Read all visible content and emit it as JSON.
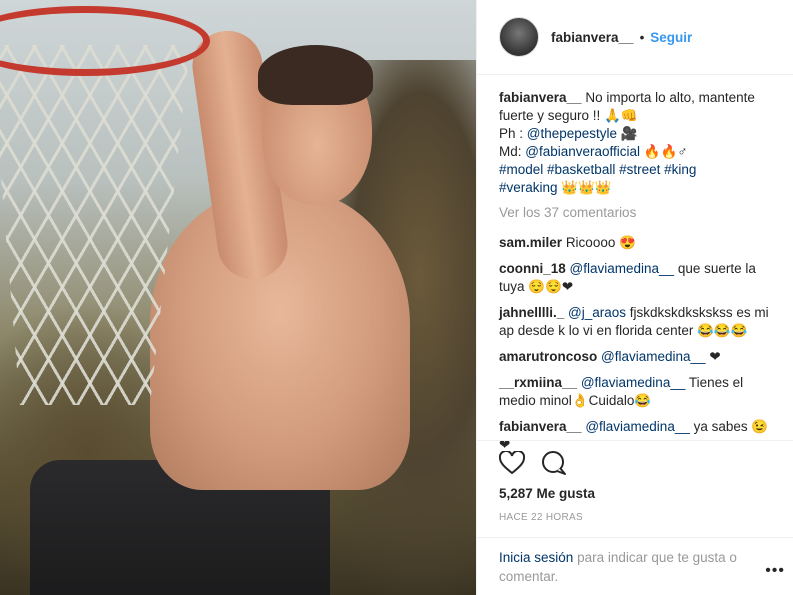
{
  "post": {
    "username": "fabianvera__",
    "follow_label": "Seguir",
    "separator": "•"
  },
  "caption": {
    "username": "fabianvera__",
    "line1": "No importa lo alto, mantente fuerte y seguro !! 🙏👊",
    "ph_prefix": "Ph :",
    "ph_handle": "@thepepestyle",
    "ph_suffix": "🎥",
    "md_prefix": "Md:",
    "md_handle": "@fabianveraofficial",
    "md_suffix": "🔥🔥♂",
    "tags": "#model #basketball #street #king",
    "tags2": "#veraking",
    "tags2_suffix": "👑👑👑"
  },
  "view_more": "Ver los 37 comentarios",
  "comments": [
    {
      "user": "sam.miler",
      "text": "Ricoooo 😍"
    },
    {
      "user": "coonni_18",
      "mention": "@flaviamedina__",
      "text": "que suerte la tuya 😌😌❤"
    },
    {
      "user": "jahnelllli._",
      "mention": "@j_araos",
      "text": "fjskdkskdkskskss es mi ap desde k lo vi en florida center 😂😂😂"
    },
    {
      "user": "amarutroncoso",
      "mention": "@flaviamedina__",
      "text": "❤"
    },
    {
      "user": "__rxmiina__",
      "mention": "@flaviamedina__",
      "text": "Tienes el medio minol👌Cuidalo😂"
    },
    {
      "user": "fabianvera__",
      "mention": "@flaviamedina__",
      "text": "ya sabes 😉❤"
    }
  ],
  "likes": "5,287 Me gusta",
  "time": "HACE 22 HORAS",
  "login": {
    "link": "Inicia sesión",
    "text": "para indicar que te gusta o comentar."
  },
  "more_options": "•••",
  "icons": [
    "heart-icon",
    "comment-icon",
    "more-options-icon"
  ]
}
